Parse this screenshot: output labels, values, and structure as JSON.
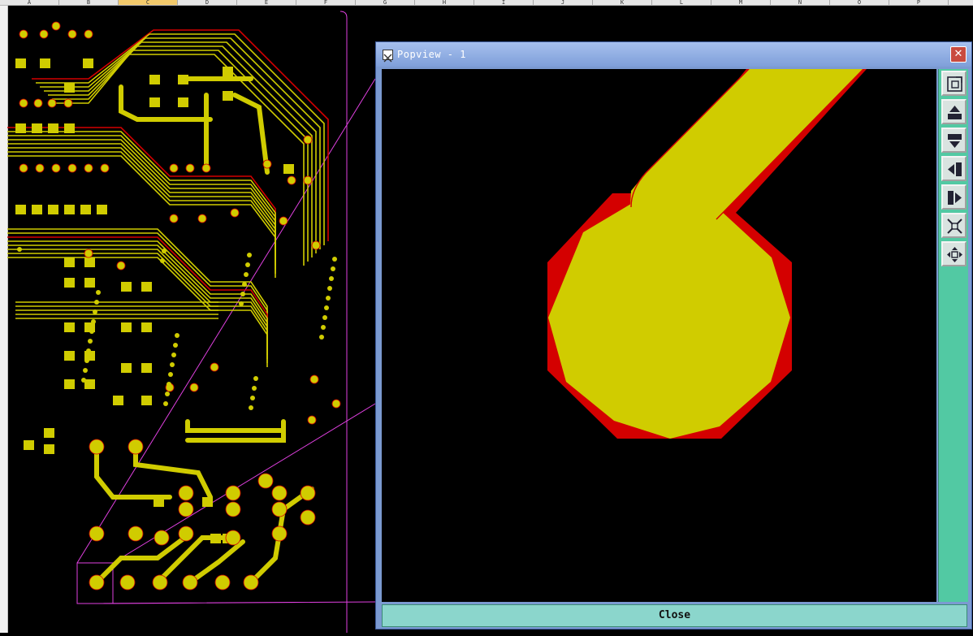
{
  "ruler": {
    "columns": [
      "A",
      "B",
      "C",
      "D",
      "E",
      "F",
      "G",
      "H",
      "I",
      "J",
      "K",
      "L",
      "M",
      "N",
      "O",
      "P",
      "Q"
    ]
  },
  "popview": {
    "title": "Popview - 1",
    "close_label": "Close",
    "close_glyph": "✕",
    "toolbar": [
      {
        "name": "zoom-window-icon"
      },
      {
        "name": "pan-up-icon"
      },
      {
        "name": "pan-down-icon"
      },
      {
        "name": "pan-left-icon"
      },
      {
        "name": "pan-right-icon"
      },
      {
        "name": "zoom-fit-icon"
      },
      {
        "name": "zoom-center-icon"
      }
    ]
  },
  "colors": {
    "copper": "#d0cc00",
    "keepout": "#d40000",
    "background": "#000000",
    "outline": "#e040e0",
    "panel": "#52c9a3"
  }
}
